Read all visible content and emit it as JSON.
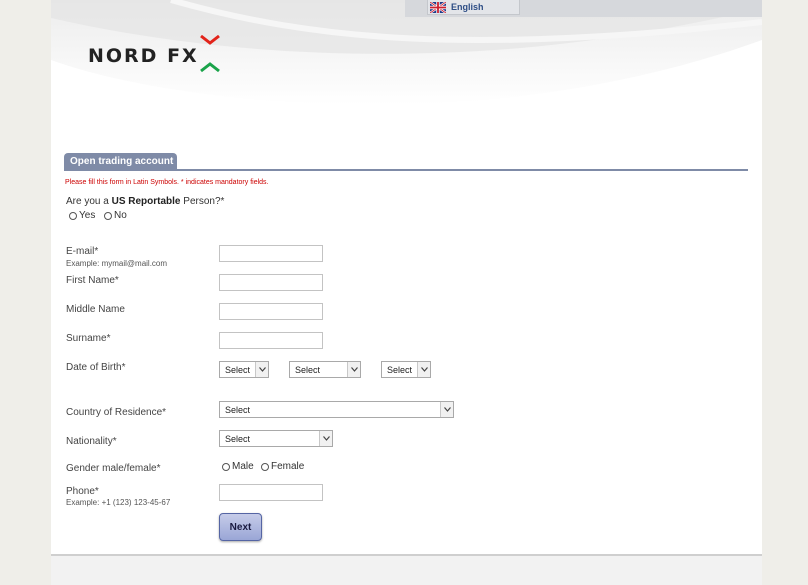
{
  "header": {
    "language": "English",
    "logo_text": "NORD FX"
  },
  "form": {
    "tab_title": "Open trading account",
    "note": "Please fill this form in Latin Symbols. * indicates mandatory fields.",
    "us_question": {
      "prefix": "Are you a ",
      "bold": "US Reportable",
      "suffix": " Person?*",
      "options": [
        "Yes",
        "No"
      ]
    },
    "email": {
      "label": "E-mail*",
      "hint": "Example: mymail@mail.com",
      "value": ""
    },
    "first_name": {
      "label": "First Name*",
      "value": ""
    },
    "middle_name": {
      "label": "Middle Name",
      "value": ""
    },
    "surname": {
      "label": "Surname*",
      "value": ""
    },
    "dob": {
      "label": "Date of Birth*",
      "day": "Select",
      "month": "Select",
      "year": "Select"
    },
    "country": {
      "label": "Country of Residence*",
      "value": "Select"
    },
    "nationality": {
      "label": "Nationality*",
      "value": "Select"
    },
    "gender": {
      "label": "Gender male/female*",
      "options": [
        "Male",
        "Female"
      ]
    },
    "phone": {
      "label": "Phone*",
      "hint": "Example: +1 (123) 123-45-67",
      "value": ""
    },
    "next_label": "Next"
  },
  "colors": {
    "accent": "#7f8ba7",
    "note_red": "#cc0000",
    "logo_green": "#1aa34a",
    "logo_red": "#e2231a"
  }
}
